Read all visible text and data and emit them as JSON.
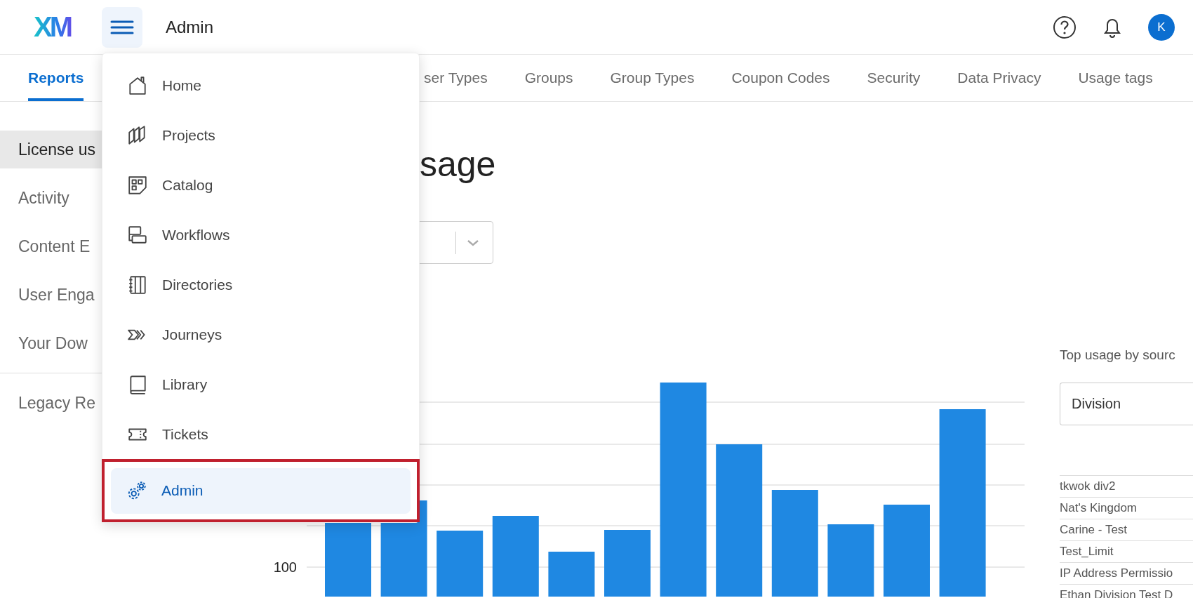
{
  "header": {
    "logo": "XM",
    "title": "Admin",
    "avatar": "K"
  },
  "tabs": [
    {
      "label": "Reports",
      "selected": true
    },
    {
      "label": "ser Types",
      "selected": false
    },
    {
      "label": "Groups",
      "selected": false
    },
    {
      "label": "Group Types",
      "selected": false
    },
    {
      "label": "Coupon Codes",
      "selected": false
    },
    {
      "label": "Security",
      "selected": false
    },
    {
      "label": "Data Privacy",
      "selected": false
    },
    {
      "label": "Usage tags",
      "selected": false
    }
  ],
  "sidebar": {
    "items": [
      {
        "label": "License us",
        "selected": true
      },
      {
        "label": "Activity",
        "selected": false
      },
      {
        "label": "Content E",
        "selected": false
      },
      {
        "label": "User Enga",
        "selected": false
      },
      {
        "label": "Your Dow",
        "selected": false
      }
    ],
    "legacy_items": [
      {
        "label": "Legacy Re",
        "selected": false
      }
    ]
  },
  "main": {
    "heading": "sage",
    "chart": {
      "axis_labels": [
        "100"
      ]
    },
    "source_panel": {
      "title": "Top usage by sourc",
      "select_value": "Division",
      "rows": [
        "tkwok div2",
        "Nat's Kingdom",
        "Carine - Test",
        "Test_Limit",
        "IP Address Permissio",
        "Ethan Division Test D"
      ]
    }
  },
  "nav_menu": {
    "items": [
      {
        "label": "Home",
        "selected": false,
        "highlighted": false
      },
      {
        "label": "Projects",
        "selected": false,
        "highlighted": false
      },
      {
        "label": "Catalog",
        "selected": false,
        "highlighted": false
      },
      {
        "label": "Workflows",
        "selected": false,
        "highlighted": false
      },
      {
        "label": "Directories",
        "selected": false,
        "highlighted": false
      },
      {
        "label": "Journeys",
        "selected": false,
        "highlighted": false
      },
      {
        "label": "Library",
        "selected": false,
        "highlighted": false
      },
      {
        "label": "Tickets",
        "selected": false,
        "highlighted": false
      },
      {
        "label": "Admin",
        "selected": true,
        "highlighted": true
      }
    ]
  }
}
